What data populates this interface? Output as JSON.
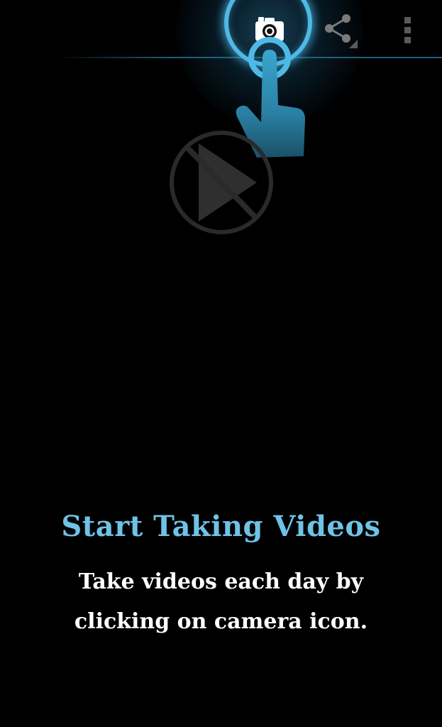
{
  "action_bar": {
    "icons": [
      "camera-icon",
      "share-icon",
      "overflow-menu-icon"
    ],
    "accent_color": "#4fb9e6"
  },
  "illustration": {
    "icons": [
      "pointing-hand-icon",
      "no-video-icon"
    ]
  },
  "intro": {
    "title": "Start Taking Videos",
    "description_line1": "Take videos each day by",
    "description_line2": "clicking on camera icon.",
    "title_color": "#6ec3e6",
    "text_color": "#ffffff"
  }
}
